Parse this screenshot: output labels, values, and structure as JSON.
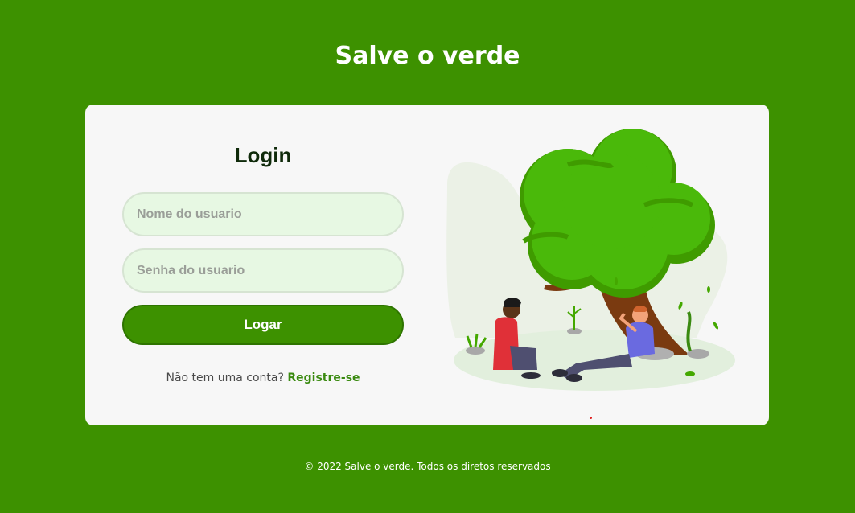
{
  "header": {
    "title": "Salve o verde"
  },
  "login": {
    "title": "Login",
    "username_placeholder": "Nome do usuario",
    "password_placeholder": "Senha do usuario",
    "submit_label": "Logar",
    "signup_prompt": "Não tem uma conta?",
    "signup_link": "Registre-se"
  },
  "footer": {
    "text": "© 2022 Salve o verde. Todos os diretos reservados"
  },
  "colors": {
    "background": "#3d9100",
    "card": "#f7f7f7",
    "input_bg": "#e7f8e3",
    "accent": "#3d9100",
    "link": "#3a8a10"
  },
  "illustration": {
    "icon": "people-under-tree-illustration"
  }
}
